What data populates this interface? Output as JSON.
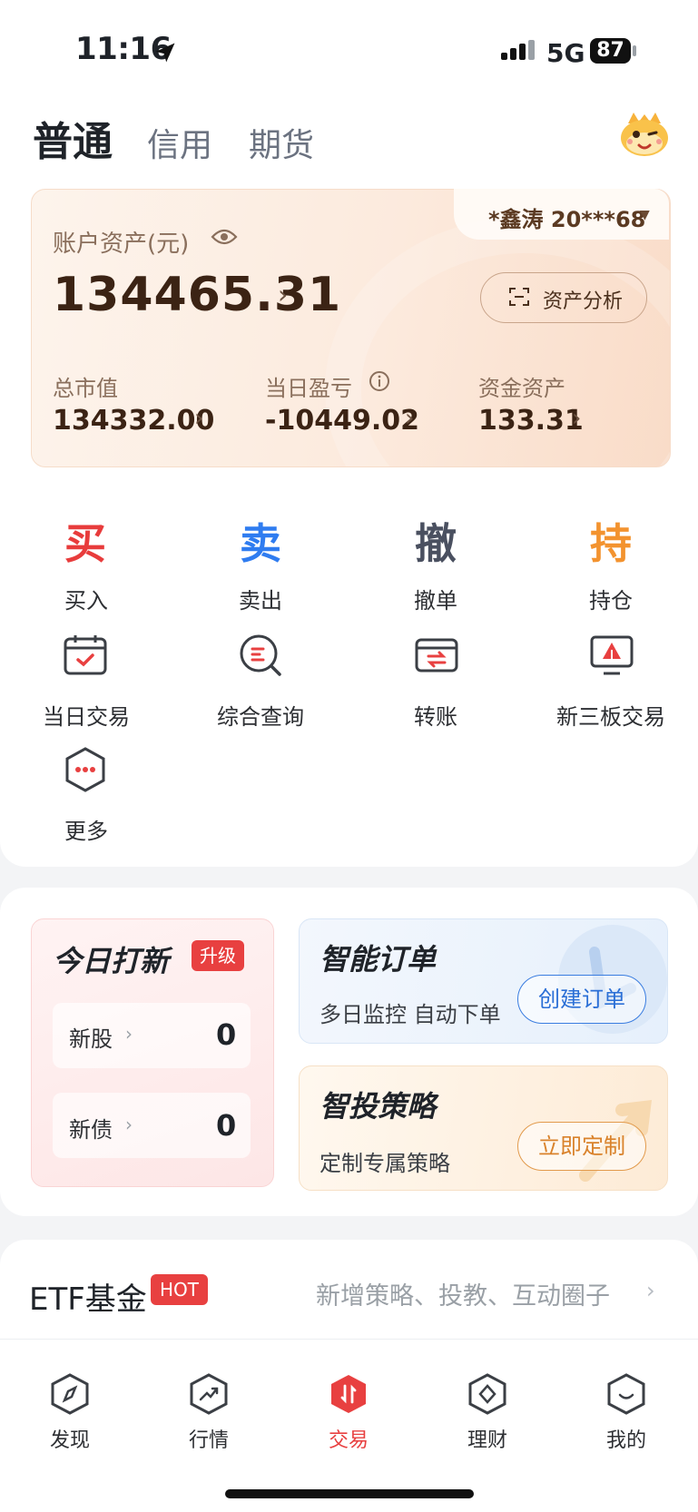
{
  "status_bar": {
    "time": "11:16",
    "network": "5G",
    "battery": "87"
  },
  "tabs": [
    "普通",
    "信用",
    "期货"
  ],
  "account": {
    "user": "*鑫涛 20***68",
    "label": "账户资产(元)",
    "total": "134465.31",
    "analysis_button": "资产分析",
    "stats": [
      {
        "label": "总市值",
        "value": "134332.00"
      },
      {
        "label": "当日盈亏",
        "value": "-10449.02"
      },
      {
        "label": "资金资产",
        "value": "133.31"
      }
    ]
  },
  "trade_actions": [
    {
      "char": "买",
      "label": "买入",
      "color": "#e83c3c"
    },
    {
      "char": "卖",
      "label": "卖出",
      "color": "#2f7cf0"
    },
    {
      "char": "撤",
      "label": "撤单",
      "color": "#4a5060"
    },
    {
      "char": "持",
      "label": "持仓",
      "color": "#f3932f"
    }
  ],
  "shortcuts": [
    {
      "label": "当日交易",
      "icon": "calendar-check-icon"
    },
    {
      "label": "综合查询",
      "icon": "search-query-icon"
    },
    {
      "label": "转账",
      "icon": "transfer-icon"
    },
    {
      "label": "新三板交易",
      "icon": "board-trading-icon"
    },
    {
      "label": "更多",
      "icon": "more-icon"
    }
  ],
  "ipo": {
    "title": "今日打新",
    "badge": "升级",
    "rows": [
      {
        "label": "新股",
        "value": "0"
      },
      {
        "label": "新债",
        "value": "0"
      }
    ]
  },
  "smart_order": {
    "title": "智能订单",
    "subtitle": "多日监控 自动下单",
    "button": "创建订单"
  },
  "strategy": {
    "title": "智投策略",
    "subtitle": "定制专属策略",
    "button": "立即定制"
  },
  "etf": {
    "title": "ETF基金",
    "badge": "HOT",
    "links": "新增策略、投教、互动圈子"
  },
  "nav": [
    {
      "label": "发现",
      "icon": "compass-icon"
    },
    {
      "label": "行情",
      "icon": "chart-trend-icon"
    },
    {
      "label": "交易",
      "icon": "trade-icon",
      "active": true
    },
    {
      "label": "理财",
      "icon": "wealth-icon"
    },
    {
      "label": "我的",
      "icon": "profile-icon"
    }
  ],
  "colors": {
    "accent_red": "#e84040",
    "brand_blue": "#2b6fd6",
    "brand_orange": "#d9822b"
  }
}
